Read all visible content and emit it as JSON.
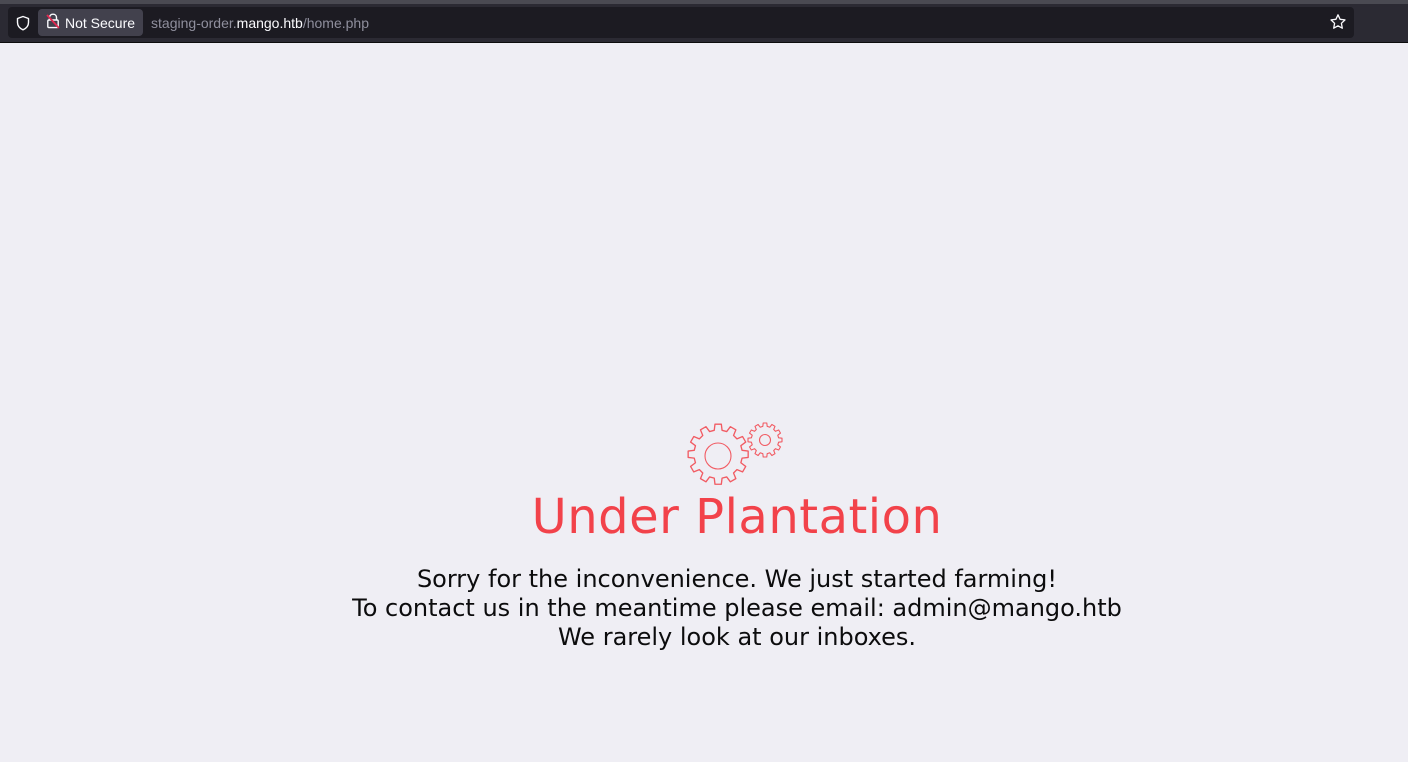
{
  "browser": {
    "security_label": "Not Secure",
    "url_prefix": "staging-order.",
    "url_host": "mango.htb",
    "url_path": "/home.php",
    "icons": [
      "shield-icon",
      "lock-warning-icon",
      "star-icon"
    ]
  },
  "page": {
    "icon": "gears-icon",
    "title": "Under Plantation",
    "lines": [
      "Sorry for the inconvenience. We just started farming!",
      "To contact us in the meantime please email: admin@mango.htb",
      "We rarely look at our inboxes."
    ]
  },
  "colors": {
    "accent": "#f2424a",
    "background": "#efeef4",
    "text": "#0c0c0d"
  }
}
